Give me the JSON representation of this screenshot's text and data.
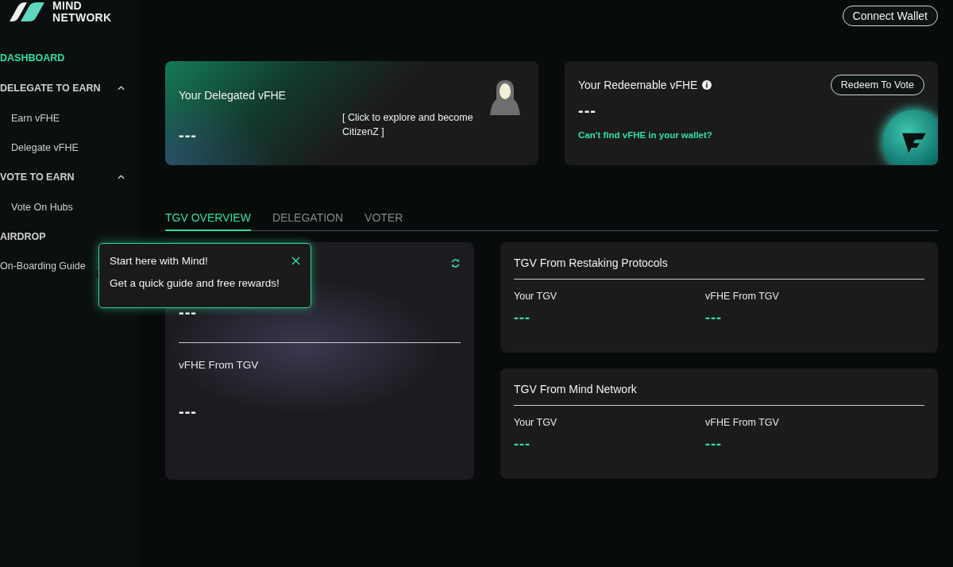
{
  "logo": {
    "line1": "MIND",
    "line2": "NETWORK"
  },
  "header": {
    "connect_button": "Connect Wallet"
  },
  "sidebar": {
    "items": [
      {
        "label": "DASHBOARD",
        "kind": "section",
        "selected": true
      },
      {
        "label": "DELEGATE TO EARN",
        "kind": "group",
        "selected": false,
        "expanded": true,
        "children": [
          {
            "label": "Earn vFHE",
            "selected": false
          },
          {
            "label": "Delegate vFHE",
            "selected": false
          }
        ]
      },
      {
        "label": "VOTE TO EARN",
        "kind": "group",
        "selected": false,
        "expanded": true,
        "children": [
          {
            "label": "Vote On Hubs",
            "selected": false
          }
        ]
      },
      {
        "label": "AIRDROP",
        "kind": "section",
        "selected": false
      },
      {
        "label": "On-Boarding Guide",
        "kind": "link",
        "selected": false
      }
    ]
  },
  "delegated_card": {
    "title": "Your Delegated vFHE",
    "value": "---",
    "cta": "[ Click to explore and become CitizenZ ]"
  },
  "redeemable_card": {
    "title": "Your Redeemable vFHE",
    "button": "Redeem To Vote",
    "value": "---",
    "link": "Can't find vFHE in your wallet?"
  },
  "tabs": [
    {
      "label": "TGV OVERVIEW",
      "selected": true
    },
    {
      "label": "DELEGATION",
      "selected": false
    },
    {
      "label": "VOTER",
      "selected": false
    }
  ],
  "overview_panel": {
    "value": "---",
    "label": "vFHE From TGV",
    "value_2": "---"
  },
  "tgv_panels": [
    {
      "title": "TGV From Restaking Protocols",
      "columns": [
        {
          "label": "Your TGV",
          "value": "---"
        },
        {
          "label": "vFHE From TGV",
          "value": "---"
        }
      ]
    },
    {
      "title": "TGV From Mind Network",
      "columns": [
        {
          "label": "Your TGV",
          "value": "---"
        },
        {
          "label": "vFHE From TGV",
          "value": "---"
        }
      ]
    }
  ],
  "tooltip": {
    "title": "Start here with Mind!",
    "text": "Get a quick guide and free rewards!"
  }
}
